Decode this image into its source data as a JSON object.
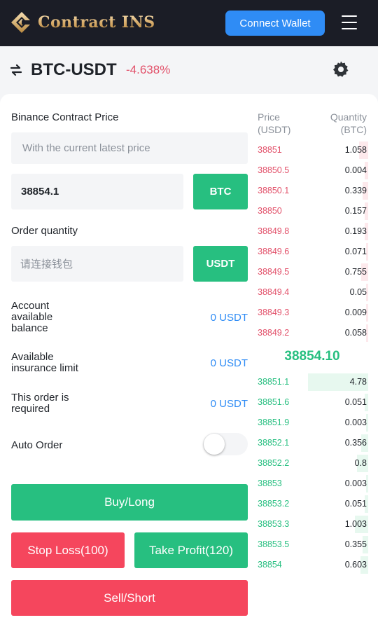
{
  "header": {
    "logo_text": "Contract INS",
    "connect_label": "Connect Wallet"
  },
  "pair": {
    "name": "BTC-USDT",
    "change": "-4.638%"
  },
  "form": {
    "price_label": "Binance Contract Price",
    "price_placeholder": "With the current latest price",
    "price_value": "38854.1",
    "price_unit": "BTC",
    "qty_label": "Order quantity",
    "qty_placeholder": "请连接钱包",
    "qty_unit": "USDT",
    "balance_label": [
      "Account",
      "available",
      "balance"
    ],
    "balance_value": "0 USDT",
    "insurance_label": [
      "Available",
      "insurance limit"
    ],
    "insurance_value": "0 USDT",
    "required_label": [
      "This order is",
      "required"
    ],
    "required_value": "0 USDT",
    "auto_order_label": "Auto Order",
    "auto_order_on": false,
    "buy_label": "Buy/Long",
    "stop_loss_label": "Stop Loss(100)",
    "take_profit_label": "Take Profit(120)",
    "sell_label": "Sell/Short"
  },
  "orderbook": {
    "price_header": [
      "Price",
      "(USDT)"
    ],
    "qty_header": [
      "Quantity",
      "(BTC)"
    ],
    "last_price": "38854.10",
    "asks": [
      {
        "price": "38851",
        "qty": "1.058",
        "depth": 0.08
      },
      {
        "price": "38850.5",
        "qty": "0.004",
        "depth": 0.03
      },
      {
        "price": "38850.1",
        "qty": "0.339",
        "depth": 0.05
      },
      {
        "price": "38850",
        "qty": "0.157",
        "depth": 0.03
      },
      {
        "price": "38849.8",
        "qty": "0.193",
        "depth": 0.03
      },
      {
        "price": "38849.6",
        "qty": "0.071",
        "depth": 0.02
      },
      {
        "price": "38849.5",
        "qty": "0.755",
        "depth": 0.06
      },
      {
        "price": "38849.4",
        "qty": "0.05",
        "depth": 0.02
      },
      {
        "price": "38849.3",
        "qty": "0.009",
        "depth": 0.02
      },
      {
        "price": "38849.2",
        "qty": "0.058",
        "depth": 0.02
      }
    ],
    "bids": [
      {
        "price": "38851.1",
        "qty": "4.78",
        "depth": 0.54
      },
      {
        "price": "38851.6",
        "qty": "0.051",
        "depth": 0.03
      },
      {
        "price": "38851.9",
        "qty": "0.003",
        "depth": 0.02
      },
      {
        "price": "38852.1",
        "qty": "0.356",
        "depth": 0.06
      },
      {
        "price": "38852.2",
        "qty": "0.8",
        "depth": 0.1
      },
      {
        "price": "38853",
        "qty": "0.003",
        "depth": 0.02
      },
      {
        "price": "38853.2",
        "qty": "0.051",
        "depth": 0.03
      },
      {
        "price": "38853.3",
        "qty": "1.003",
        "depth": 0.12
      },
      {
        "price": "38853.5",
        "qty": "0.355",
        "depth": 0.05
      },
      {
        "price": "38854",
        "qty": "0.603",
        "depth": 0.07
      }
    ]
  },
  "colors": {
    "buy": "#27bf80",
    "sell": "#f5465d",
    "link": "#2f8cf5",
    "header_bg": "#1b1d26"
  },
  "icons": {
    "logo": "logo-mark-icon",
    "menu": "hamburger-menu-icon",
    "swap": "swap-arrows-icon",
    "settings": "gear-icon"
  }
}
